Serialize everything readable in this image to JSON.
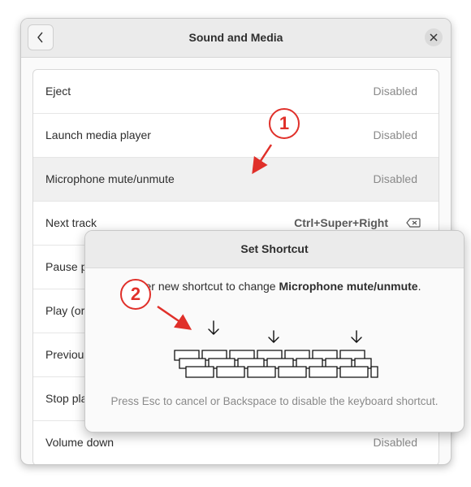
{
  "window": {
    "title": "Sound and Media"
  },
  "shortcuts": [
    {
      "label": "Eject",
      "value": "Disabled"
    },
    {
      "label": "Launch media player",
      "value": "Disabled"
    },
    {
      "label": "Microphone mute/unmute",
      "value": "Disabled"
    },
    {
      "label": "Next track",
      "value": "Ctrl+Super+Right"
    },
    {
      "label": "Pause p",
      "value": ""
    },
    {
      "label": "Play (or",
      "value": ""
    },
    {
      "label": "Previou",
      "value": ""
    },
    {
      "label": "Stop pla",
      "value": ""
    },
    {
      "label": "Volume down",
      "value": "Disabled"
    }
  ],
  "dialog": {
    "title": "Set Shortcut",
    "message_prefix": "Enter new shortcut to change ",
    "message_target": "Microphone mute/unmute",
    "message_suffix": ".",
    "hint": "Press Esc to cancel or Backspace to disable the keyboard shortcut."
  },
  "annotations": [
    {
      "number": "1"
    },
    {
      "number": "2"
    }
  ],
  "colors": {
    "annotation_red": "#e0302a",
    "highlight_row": "#f0f0f0"
  }
}
